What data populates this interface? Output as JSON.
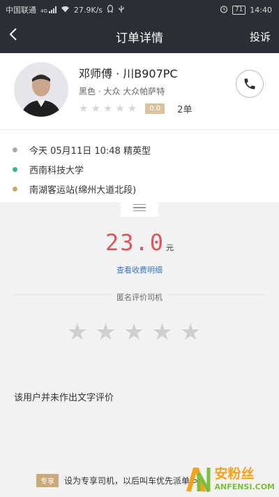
{
  "statusbar": {
    "carrier": "中国联通",
    "network": "4G",
    "speed": "27.9K/s",
    "battery": "71",
    "time": "14:40"
  },
  "nav": {
    "back_icon": "chevron-left-icon",
    "title": "订单详情",
    "action": "投诉"
  },
  "driver": {
    "name": "邓师傅 · 川B907PC",
    "car": "黑色 · 大众 大众帕萨特",
    "score": "0.0",
    "orders": "2单",
    "stars": 0
  },
  "trip": {
    "time": "今天 05月11日 10:48 精英型",
    "start": "西南科技大学",
    "end": "南湖客运站(绵州大道北段)",
    "colors": {
      "time": "#a8a8a8",
      "start": "#3bb38a",
      "end": "#c8a86a"
    }
  },
  "fee": {
    "amount": "23.0",
    "unit": "元",
    "detail_link": "查看收费明细"
  },
  "review": {
    "label": "匿名评价司机",
    "stars": 0,
    "comment": "该用户并未作出文字评价"
  },
  "tip": {
    "badge": "专享",
    "text": "设为专享司机，以后叫车优先派单 >"
  },
  "watermark": {
    "cn": "安粉丝",
    "en": "ANFENSI.COM"
  }
}
